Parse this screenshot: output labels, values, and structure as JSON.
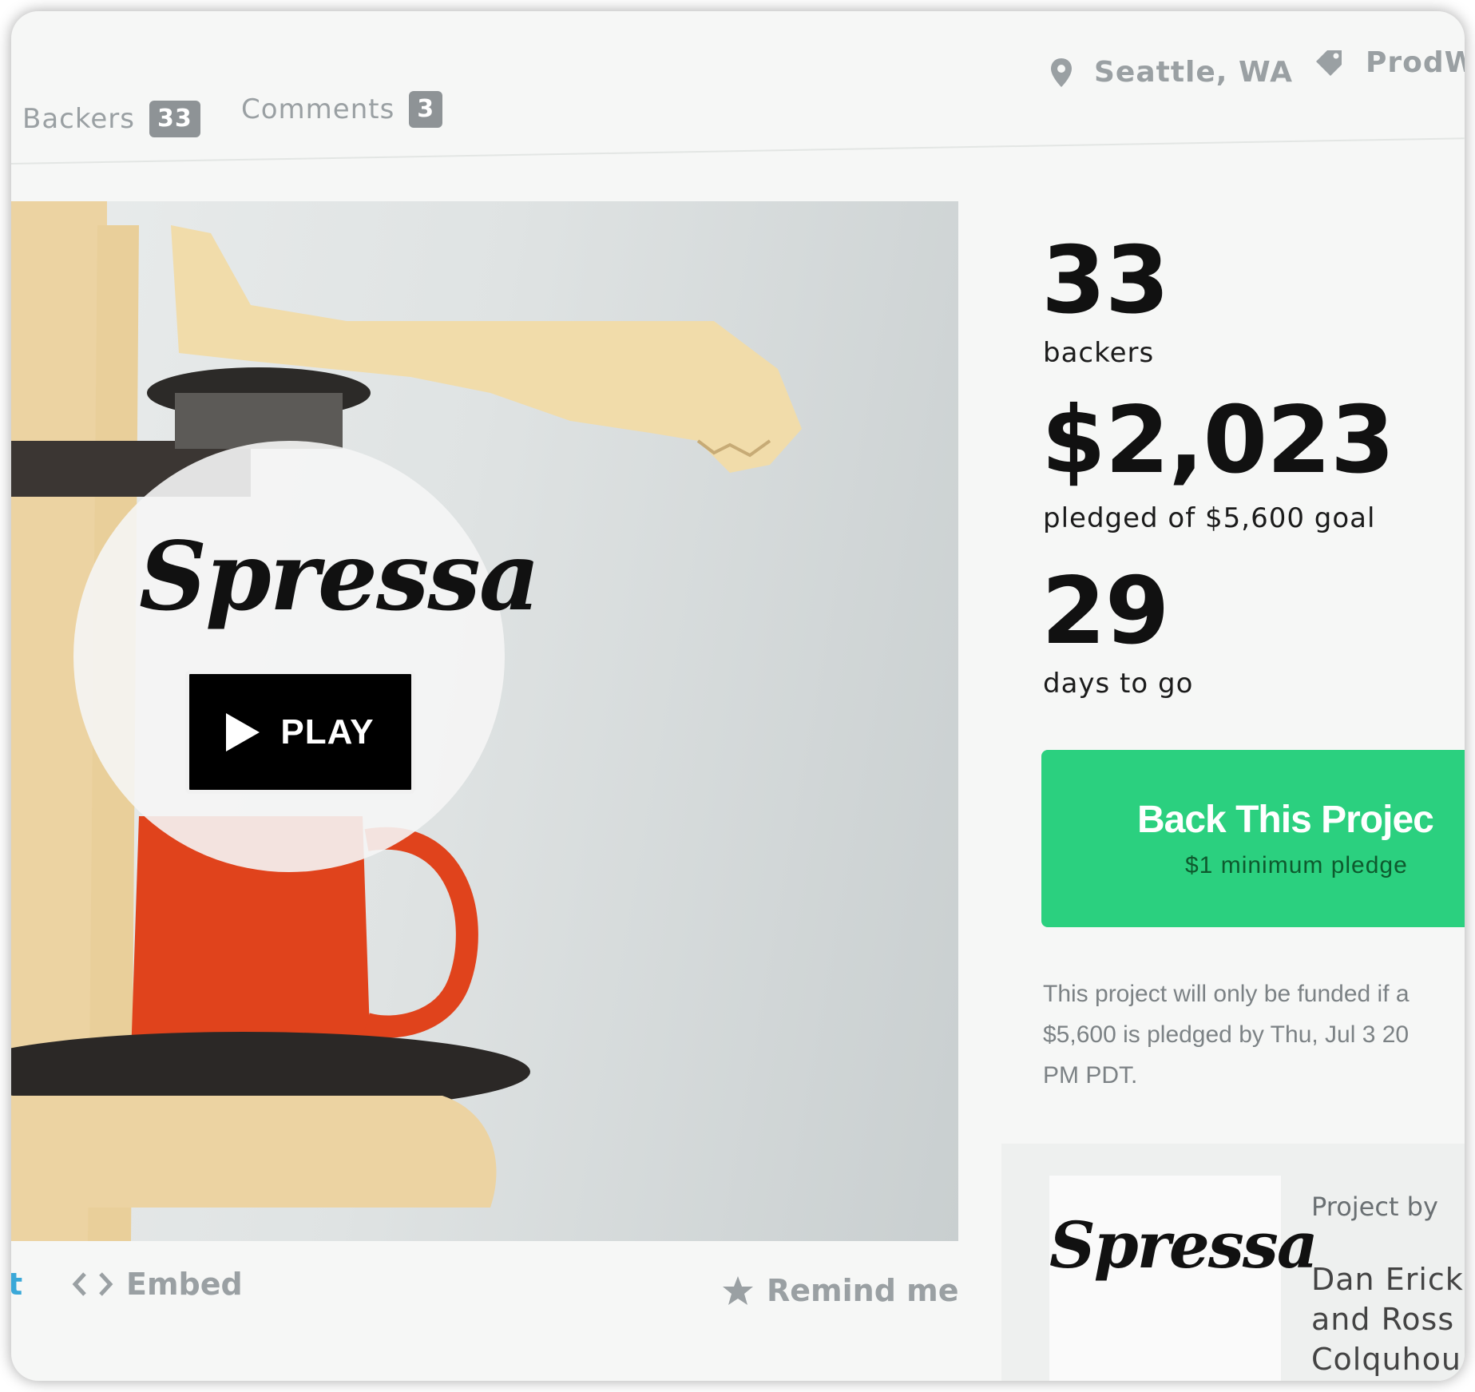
{
  "nav": {
    "backers_label": "Backers",
    "backers_count": "33",
    "comments_label": "Comments",
    "comments_count": "3",
    "location": "Seattle, WA",
    "category": "ProdW"
  },
  "video": {
    "logo_text": "Spressa",
    "play_label": "PLAY"
  },
  "actions": {
    "share_fragment": "t",
    "embed_label": "Embed",
    "remind_label": "Remind me"
  },
  "stats": {
    "backers_value": "33",
    "backers_label": "backers",
    "pledged_value": "$2,023",
    "pledged_label": "pledged of $5,600 goal",
    "days_value": "29",
    "days_label": "days to go"
  },
  "back_button": {
    "label": "Back This Projec",
    "sub_label": "$1 minimum pledge"
  },
  "funding_notice": {
    "line1": "This project will only be funded if a",
    "line2": "$5,600 is pledged by Thu, Jul 3 20",
    "line3": "PM PDT."
  },
  "creator": {
    "logo_text": "Spressa",
    "project_by_label": "Project by",
    "name_line1": "Dan Ericks",
    "name_line2": "and Ross",
    "name_line3": "Colquhou"
  },
  "colors": {
    "accent_green": "#2bd07f",
    "mug_red": "#e0431c",
    "wood": "#e9cf9a"
  }
}
